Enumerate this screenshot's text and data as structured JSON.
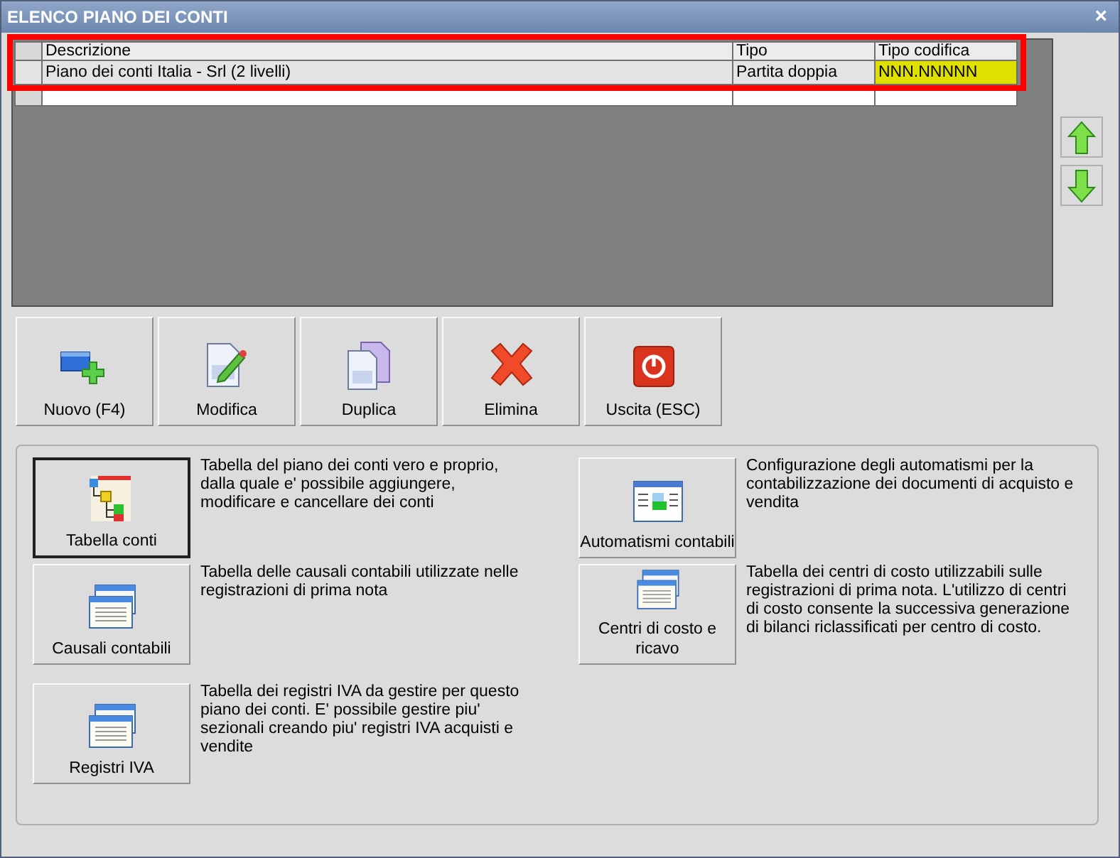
{
  "window": {
    "title": "ELENCO PIANO DEI CONTI",
    "close": "×"
  },
  "table": {
    "columns": [
      "Descrizione",
      "Tipo",
      "Tipo codifica"
    ],
    "rows": [
      {
        "selected": true,
        "cells": [
          {
            "text": "Piano dei conti Italia - Srl (2 livelli)",
            "highlighted": false
          },
          {
            "text": "Partita doppia",
            "highlighted": false
          },
          {
            "text": "NNN.NNNNN",
            "highlighted": true
          }
        ]
      }
    ],
    "annotation": {
      "kind": "frame",
      "color": "#ff0000"
    }
  },
  "toolbar": [
    {
      "label": "Nuovo (F4)",
      "kind": "new"
    },
    {
      "label": "Modifica",
      "kind": "edit"
    },
    {
      "label": "Duplica",
      "kind": "duplicate"
    },
    {
      "label": "Elimina",
      "kind": "delete"
    },
    {
      "label": "Uscita (ESC)",
      "kind": "exit"
    }
  ],
  "sections": [
    {
      "label": "Tabella conti",
      "kind": "tree",
      "focused": true,
      "description": "Tabella del piano dei conti vero e proprio, dalla quale e' possibile aggiungere, modificare e cancellare dei conti"
    },
    {
      "label": "Automatismi contabili",
      "kind": "form",
      "focused": false,
      "description": "Configurazione degli automatismi per la contabilizzazione dei documenti di acquisto e vendita"
    },
    {
      "label": "Causali contabili",
      "kind": "windows",
      "focused": false,
      "description": "Tabella delle causali contabili utilizzate nelle registrazioni di prima nota"
    },
    {
      "label": "Centri di costo e ricavo",
      "kind": "windows",
      "focused": false,
      "description": "Tabella dei centri di costo utilizzabili sulle registrazioni di prima nota. L'utilizzo di centri di costo consente la successiva generazione di bilanci riclassificati per centro di costo."
    },
    {
      "label": "Registri IVA",
      "kind": "windows",
      "focused": false,
      "description": "Tabella dei registri IVA da gestire per questo piano dei conti. E' possibile gestire piu' sezionali creando piu' registri IVA acquisti e vendite"
    }
  ]
}
